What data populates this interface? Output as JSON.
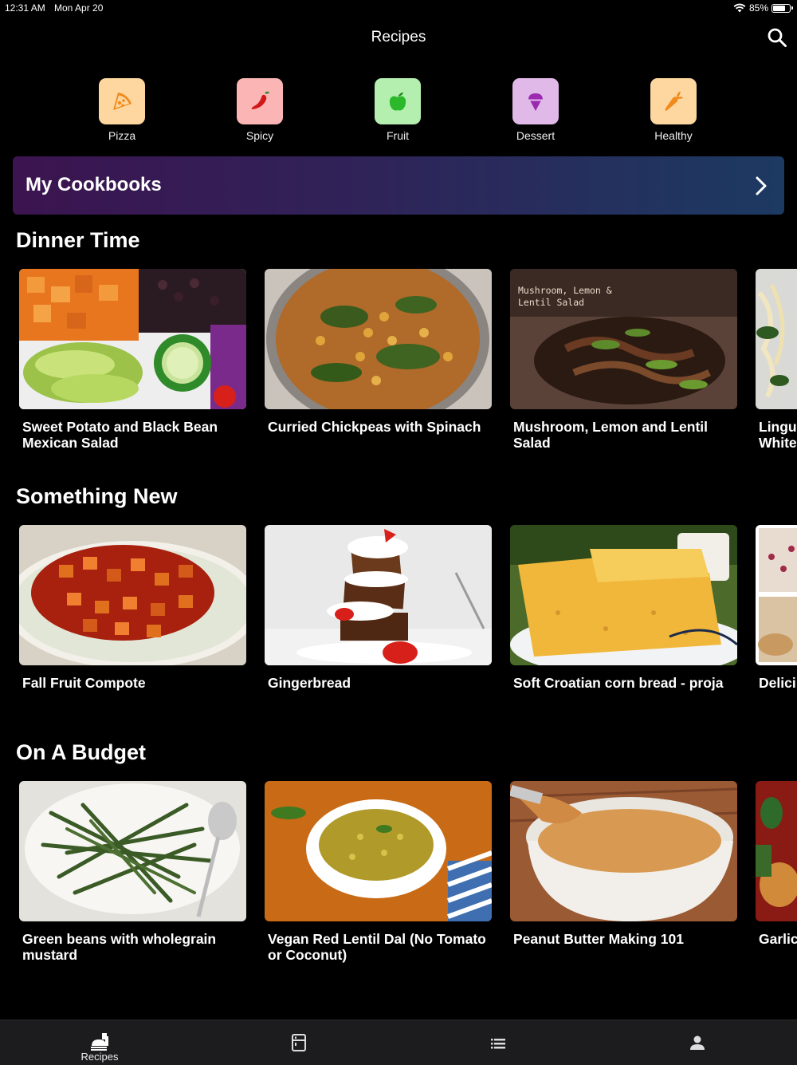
{
  "status_bar": {
    "time": "12:31 AM",
    "date": "Mon Apr 20",
    "battery": "85%",
    "battery_level": 0.85
  },
  "nav": {
    "title": "Recipes",
    "search_icon": "search-icon"
  },
  "categories": [
    {
      "label": "Pizza",
      "icon": "pizza-icon",
      "bg": "#fdd6a0",
      "color": "#f08a1c"
    },
    {
      "label": "Spicy",
      "icon": "chili-pepper-icon",
      "bg": "#fbb5b5",
      "color": "#d01818"
    },
    {
      "label": "Fruit",
      "icon": "apple-icon",
      "bg": "#b5efb0",
      "color": "#2bb82b"
    },
    {
      "label": "Dessert",
      "icon": "ice-cream-icon",
      "bg": "#e1b9e8",
      "color": "#9b2ab0"
    },
    {
      "label": "Healthy",
      "icon": "carrot-icon",
      "bg": "#fdd6a0",
      "color": "#f08a1c"
    }
  ],
  "cookbooks": {
    "label": "My Cookbooks",
    "icon": "chevron-right-icon"
  },
  "sections": [
    {
      "title": "Dinner Time",
      "recipes": [
        {
          "title": "Sweet Potato and Black Bean Mexican Salad",
          "image": "sweet-potato-salad-photo"
        },
        {
          "title": "Curried Chickpeas with Spinach",
          "image": "curried-chickpeas-photo"
        },
        {
          "title": "Mushroom, Lemon and Lentil Salad",
          "image": "mushroom-lentil-salad-photo",
          "overlay": "Mushroom, Lemon &\nLentil Salad"
        },
        {
          "title": "Lingu\nWhite",
          "image": "linguine-photo"
        }
      ]
    },
    {
      "title": "Something New",
      "recipes": [
        {
          "title": "Fall Fruit Compote",
          "image": "fruit-compote-photo"
        },
        {
          "title": "Gingerbread",
          "image": "gingerbread-photo"
        },
        {
          "title": "Soft Croatian corn bread - proja",
          "image": "corn-bread-photo"
        },
        {
          "title": "Delici",
          "image": "loaf-photo"
        }
      ]
    },
    {
      "title": "On A Budget",
      "recipes": [
        {
          "title": "Green beans with wholegrain mustard",
          "image": "green-beans-photo"
        },
        {
          "title": "Vegan Red Lentil Dal (No Tomato or Coconut)",
          "image": "lentil-dal-photo"
        },
        {
          "title": "Peanut Butter Making 101",
          "image": "peanut-butter-photo"
        },
        {
          "title": "Garlic",
          "image": "garlic-dish-photo"
        }
      ]
    }
  ],
  "tab_bar": [
    {
      "label": "Recipes",
      "icon": "recipes-icon",
      "active": true
    },
    {
      "label": "",
      "icon": "fridge-icon",
      "active": false
    },
    {
      "label": "",
      "icon": "list-icon",
      "active": false
    },
    {
      "label": "",
      "icon": "profile-icon",
      "active": false
    }
  ]
}
